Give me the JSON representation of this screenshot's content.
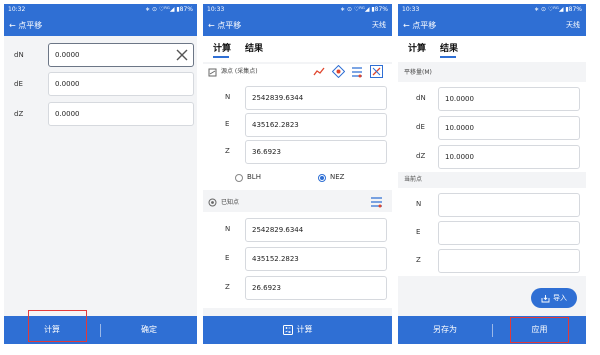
{
  "screen1": {
    "status_time": "10:32",
    "status_right": "∗ ⊙ ♡ᴿᴳ◢ ▮87%",
    "title": "← 点平移",
    "fields": [
      {
        "label": "dN",
        "value": "0.0000"
      },
      {
        "label": "dE",
        "value": "0.0000"
      },
      {
        "label": "dZ",
        "value": "0.0000"
      }
    ],
    "bottom_left": "计算",
    "bottom_right": "确定"
  },
  "screen2": {
    "status_time": "10:33",
    "status_right": "∗ ⊙ ♡ᴿᴳ◢ ▮87%",
    "title": "← 点平移",
    "title_right": "天线",
    "tab_calc": "计算",
    "tab_result": "结果",
    "source_section": "源点 (采集点)",
    "source_rows": [
      {
        "label": "N",
        "value": "2542839.6344"
      },
      {
        "label": "E",
        "value": "435162.2823"
      },
      {
        "label": "Z",
        "value": "36.6923"
      }
    ],
    "radio_blh": "BLH",
    "radio_nez": "NEZ",
    "known_section": "已知点",
    "known_rows": [
      {
        "label": "N",
        "value": "2542829.6344"
      },
      {
        "label": "E",
        "value": "435152.2823"
      },
      {
        "label": "Z",
        "value": "26.6923"
      }
    ],
    "bottom_calc": "计算"
  },
  "screen3": {
    "status_time": "10:33",
    "status_right": "∗ ⊙ ♡ᴿᴳ◢ ▮87%",
    "title": "← 点平移",
    "title_right": "天线",
    "tab_calc": "计算",
    "tab_result": "结果",
    "shift_section": "平移量(M)",
    "shift_rows": [
      {
        "label": "dN",
        "value": "10.0000"
      },
      {
        "label": "dE",
        "value": "10.0000"
      },
      {
        "label": "dZ",
        "value": "10.0000"
      }
    ],
    "current_section": "当前点",
    "current_rows": [
      {
        "label": "N",
        "value": ""
      },
      {
        "label": "E",
        "value": ""
      },
      {
        "label": "Z",
        "value": ""
      }
    ],
    "import_label": "导入",
    "bottom_saveas": "另存为",
    "bottom_apply": "应用"
  }
}
